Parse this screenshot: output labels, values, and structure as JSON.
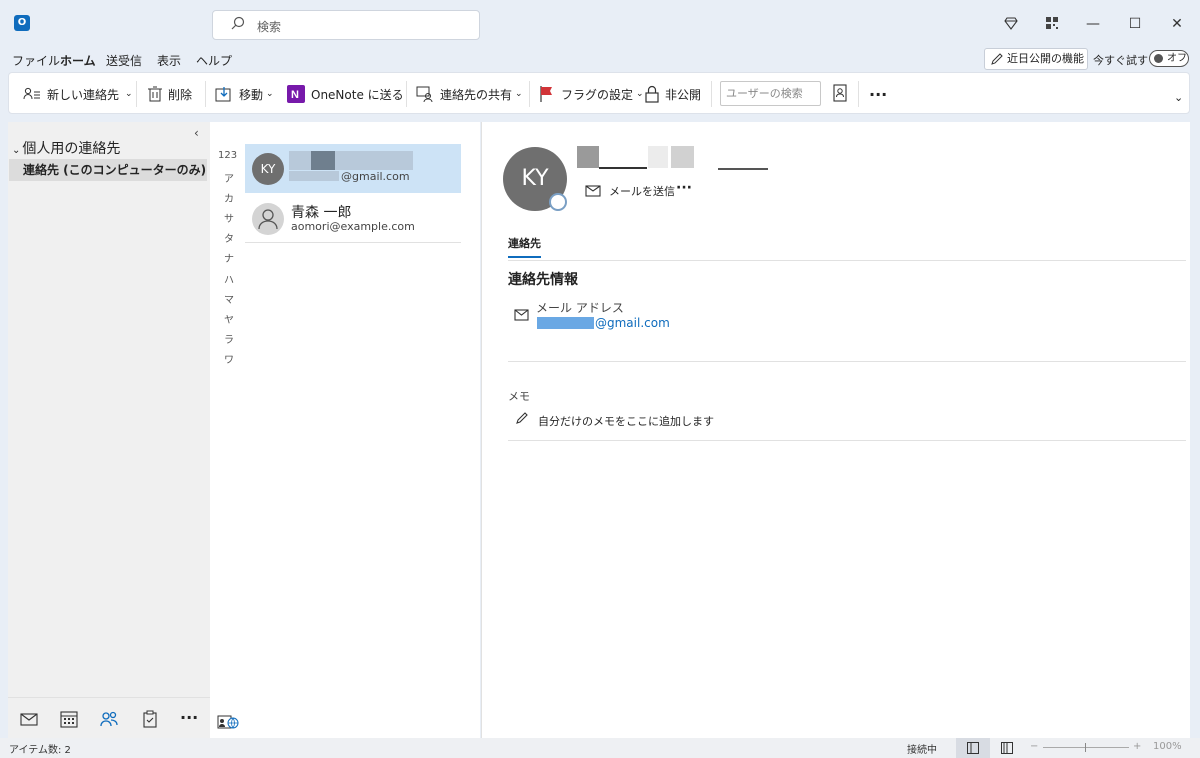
{
  "titlebar": {
    "app_logo": "O",
    "search_placeholder": "検索"
  },
  "menu": {
    "tabs": [
      "ファイル",
      "ホーム",
      "送受信",
      "表示",
      "ヘルプ"
    ],
    "active_tab": "ホーム",
    "feature_button": "近日公開の機能",
    "try_now": "今すぐ試す",
    "toggle": "オフ"
  },
  "ribbon": {
    "new_contact": "新しい連絡先",
    "delete": "削除",
    "move": "移動",
    "onenote": "OneNote に送る",
    "share_contact": "連絡先の共有",
    "flag": "フラグの設定",
    "private": "非公開",
    "user_search_placeholder": "ユーザーの検索",
    "more": "···"
  },
  "folders": {
    "group": "個人用の連絡先",
    "items": [
      "連絡先 (このコンピューターのみ)"
    ]
  },
  "index": [
    "123",
    "ア",
    "カ",
    "サ",
    "タ",
    "ナ",
    "ハ",
    "マ",
    "ヤ",
    "ラ",
    "ワ"
  ],
  "contacts": [
    {
      "initials": "KY",
      "name": "",
      "email": "@gmail.com",
      "selected": true
    },
    {
      "initials": "",
      "name": "青森 一郎",
      "email": "aomori@example.com",
      "selected": false
    }
  ],
  "reading": {
    "initials": "KY",
    "send_mail": "メールを送信",
    "more": "···",
    "tab": "連絡先",
    "section_title": "連絡先情報",
    "email_label": "メール アドレス",
    "email_value": "@gmail.com",
    "memo_label": "メモ",
    "memo_placeholder": "自分だけのメモをここに追加します"
  },
  "status": {
    "items": "アイテム数: 2",
    "connection": "接続中",
    "zoom": "100%"
  },
  "colors": {
    "accent": "#0f6cbd",
    "selected": "#cde3f6"
  }
}
